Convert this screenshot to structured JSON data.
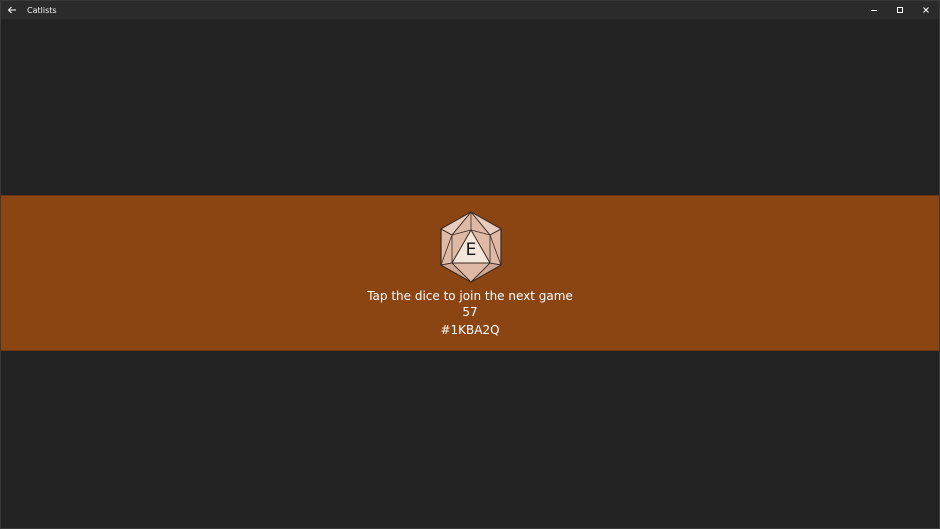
{
  "window": {
    "title": "Catlists"
  },
  "banner": {
    "color": "#8b4513",
    "dice_letter": "E",
    "instruction": "Tap the dice to join the next game",
    "count": "57",
    "game_code": "#1KBA2Q"
  },
  "icons": {
    "back": "arrow-left-icon",
    "minimize": "minimize-icon",
    "maximize": "maximize-icon",
    "close": "close-icon",
    "dice": "d20-dice-icon"
  }
}
